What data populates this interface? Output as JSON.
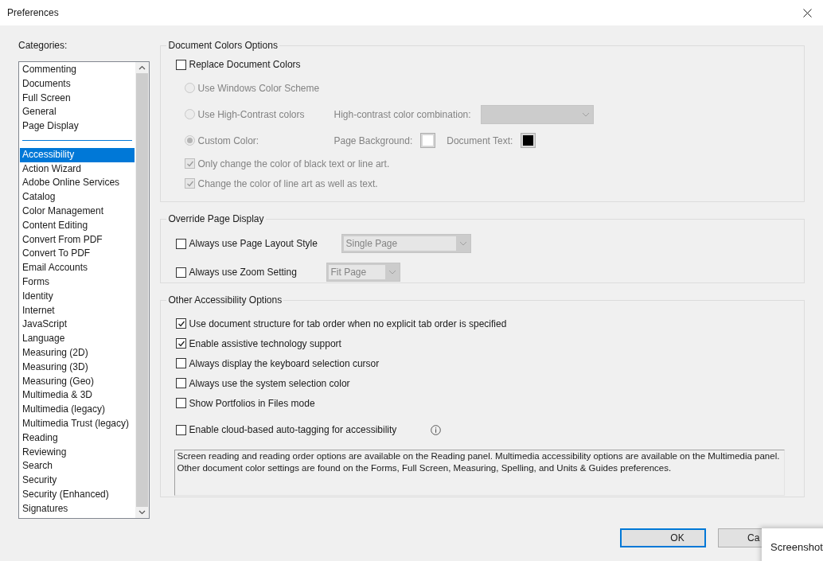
{
  "window": {
    "title": "Preferences"
  },
  "categories": {
    "label": "Categories:",
    "items": [
      {
        "kind": "item",
        "label": "Commenting",
        "selected": false
      },
      {
        "kind": "item",
        "label": "Documents",
        "selected": false
      },
      {
        "kind": "item",
        "label": "Full Screen",
        "selected": false
      },
      {
        "kind": "item",
        "label": "General",
        "selected": false
      },
      {
        "kind": "item",
        "label": "Page Display",
        "selected": false
      },
      {
        "kind": "separator"
      },
      {
        "kind": "item",
        "label": "Accessibility",
        "selected": true
      },
      {
        "kind": "item",
        "label": "Action Wizard",
        "selected": false
      },
      {
        "kind": "item",
        "label": "Adobe Online Services",
        "selected": false
      },
      {
        "kind": "item",
        "label": "Catalog",
        "selected": false
      },
      {
        "kind": "item",
        "label": "Color Management",
        "selected": false
      },
      {
        "kind": "item",
        "label": "Content Editing",
        "selected": false
      },
      {
        "kind": "item",
        "label": "Convert From PDF",
        "selected": false
      },
      {
        "kind": "item",
        "label": "Convert To PDF",
        "selected": false
      },
      {
        "kind": "item",
        "label": "Email Accounts",
        "selected": false
      },
      {
        "kind": "item",
        "label": "Forms",
        "selected": false
      },
      {
        "kind": "item",
        "label": "Identity",
        "selected": false
      },
      {
        "kind": "item",
        "label": "Internet",
        "selected": false
      },
      {
        "kind": "item",
        "label": "JavaScript",
        "selected": false
      },
      {
        "kind": "item",
        "label": "Language",
        "selected": false
      },
      {
        "kind": "item",
        "label": "Measuring (2D)",
        "selected": false
      },
      {
        "kind": "item",
        "label": "Measuring (3D)",
        "selected": false
      },
      {
        "kind": "item",
        "label": "Measuring (Geo)",
        "selected": false
      },
      {
        "kind": "item",
        "label": "Multimedia & 3D",
        "selected": false
      },
      {
        "kind": "item",
        "label": "Multimedia (legacy)",
        "selected": false
      },
      {
        "kind": "item",
        "label": "Multimedia Trust (legacy)",
        "selected": false
      },
      {
        "kind": "item",
        "label": "Reading",
        "selected": false
      },
      {
        "kind": "item",
        "label": "Reviewing",
        "selected": false
      },
      {
        "kind": "item",
        "label": "Search",
        "selected": false
      },
      {
        "kind": "item",
        "label": "Security",
        "selected": false
      },
      {
        "kind": "item",
        "label": "Security (Enhanced)",
        "selected": false
      },
      {
        "kind": "item",
        "label": "Signatures",
        "selected": false
      }
    ]
  },
  "document_colors": {
    "title": "Document Colors Options",
    "replace": {
      "label": "Replace Document Colors",
      "checked": false
    },
    "disabled": true,
    "radios": [
      {
        "kind": "plain",
        "label": "Use Windows Color Scheme",
        "selected": false
      },
      {
        "kind": "combo",
        "label": "Use High-Contrast colors",
        "selected": false,
        "combo_label": "High-contrast color combination:"
      },
      {
        "kind": "custom",
        "label": "Custom Color:",
        "selected": true,
        "swatches": [
          {
            "label": "Page Background:",
            "color": "#ffffff"
          },
          {
            "label": "Document Text:",
            "color": "#000000"
          }
        ]
      }
    ],
    "checkboxes": [
      {
        "label": "Only change the color of black text or line art.",
        "checked": true
      },
      {
        "label": "Change the color of line art as well as text.",
        "checked": true
      }
    ]
  },
  "override_page_display": {
    "title": "Override Page Display",
    "rows": [
      {
        "label": "Always use Page Layout Style",
        "checked": false,
        "dropdown": "Single Page"
      },
      {
        "label": "Always use Zoom Setting",
        "checked": false,
        "dropdown": "Fit Page"
      }
    ]
  },
  "other_accessibility": {
    "title": "Other Accessibility Options",
    "checkboxes": [
      {
        "label": "Use document structure for tab order when no explicit tab order is specified",
        "checked": true
      },
      {
        "label": "Enable assistive technology support",
        "checked": true
      },
      {
        "label": "Always display the keyboard selection cursor",
        "checked": false
      },
      {
        "label": "Always use the system selection color",
        "checked": false
      },
      {
        "label": "Show Portfolios in Files mode",
        "checked": false
      }
    ],
    "cloud": {
      "label": "Enable cloud-based auto-tagging for accessibility",
      "checked": false
    },
    "note": "Screen reading and reading order options are available on the Reading panel. Multimedia accessibility options are available on the Multimedia panel. Other document color settings are found on the Forms, Full Screen, Measuring, Spelling, and Units & Guides preferences."
  },
  "buttons": [
    {
      "label": "OK",
      "default": true
    },
    {
      "label": "Ca",
      "default": false
    }
  ],
  "toast": {
    "text": "Screenshot"
  }
}
